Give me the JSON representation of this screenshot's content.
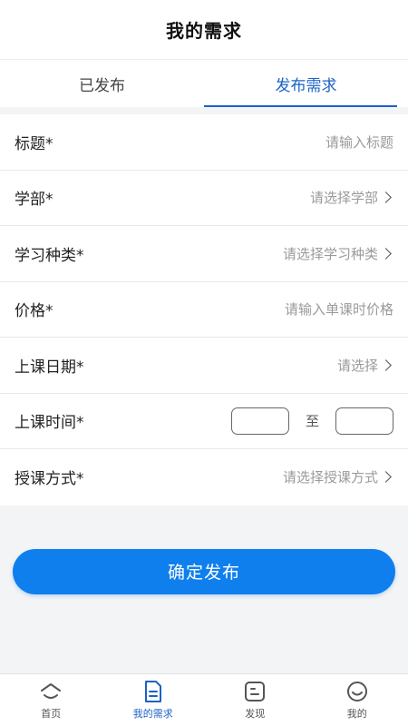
{
  "header": {
    "title": "我的需求"
  },
  "tabs": [
    {
      "label": "已发布"
    },
    {
      "label": "发布需求"
    }
  ],
  "form": {
    "rows": [
      {
        "label": "标题*",
        "placeholder": "请输入标题"
      },
      {
        "label": "学部*",
        "placeholder": "请选择学部"
      },
      {
        "label": "学习种类*",
        "placeholder": "请选择学习种类"
      },
      {
        "label": "价格*",
        "placeholder": "请输入单课时价格"
      },
      {
        "label": "上课日期*",
        "placeholder": "请选择"
      },
      {
        "label": "上课时间*",
        "separator": "至"
      },
      {
        "label": "授课方式*",
        "placeholder": "请选择授课方式"
      }
    ]
  },
  "submit": {
    "label": "确定发布"
  },
  "nav": [
    {
      "label": "首页",
      "icon": "home-icon"
    },
    {
      "label": "我的需求",
      "icon": "document-icon"
    },
    {
      "label": "发现",
      "icon": "discover-icon"
    },
    {
      "label": "我的",
      "icon": "profile-icon"
    }
  ],
  "colors": {
    "primary": "#1b62c6",
    "button": "#0f7fee"
  }
}
